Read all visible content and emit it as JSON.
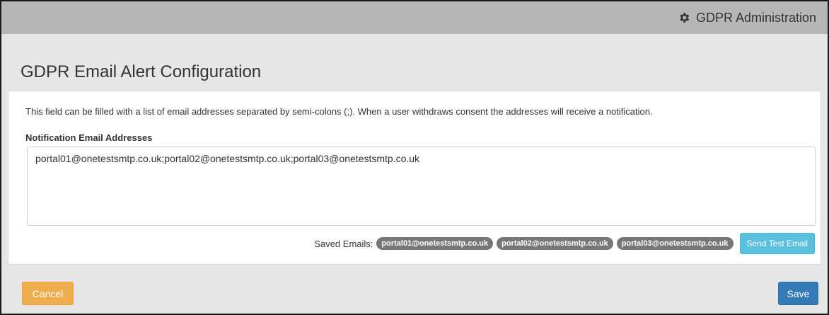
{
  "header": {
    "title": "GDPR Administration",
    "icon": "gear-icon"
  },
  "page": {
    "title": "GDPR Email Alert Configuration"
  },
  "form": {
    "help_text": "This field can be filled with a list of email addresses separated by semi-colons (;). When a user withdraws consent the addresses will receive a notification.",
    "field_label": "Notification Email Addresses",
    "field_value": "portal01@onetestsmtp.co.uk;portal02@onetestsmtp.co.uk;portal03@onetestsmtp.co.uk",
    "saved_label": "Saved Emails:",
    "saved_emails": [
      "portal01@onetestsmtp.co.uk",
      "portal02@onetestsmtp.co.uk",
      "portal03@onetestsmtp.co.uk"
    ],
    "test_button_label": "Send Test Email"
  },
  "footer": {
    "cancel_label": "Cancel",
    "save_label": "Save"
  },
  "colors": {
    "topbar": "#b7b7b7",
    "cancel": "#f0ad4e",
    "save": "#337ab7",
    "test": "#5bc0de",
    "badge": "#777777"
  }
}
